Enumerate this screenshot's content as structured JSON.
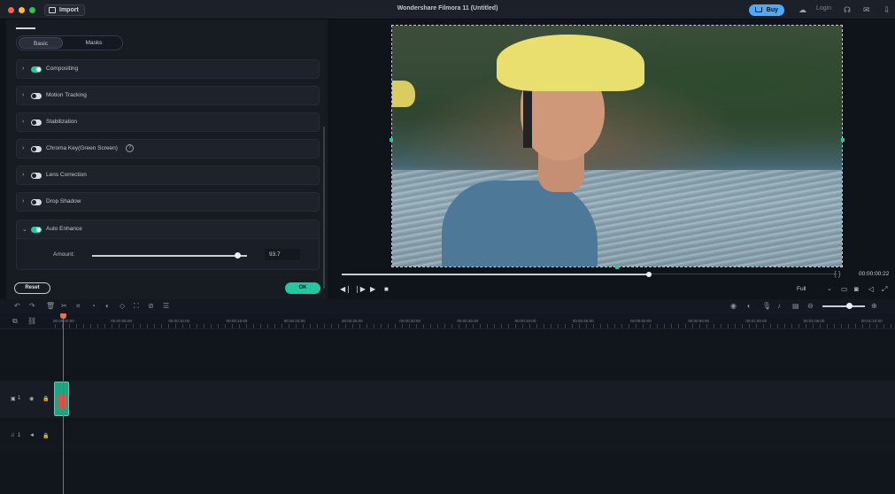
{
  "window": {
    "title": "Wondershare Filmora 11 (Untitled)",
    "import_label": "Import",
    "buy_label": "Buy",
    "login_label": "Login",
    "traffic_lights": [
      "#ff5f57",
      "#febc2e",
      "#28c840"
    ]
  },
  "panel": {
    "tabs": [
      {
        "label": "Basic",
        "active": true
      },
      {
        "label": "Masks",
        "active": false
      }
    ],
    "sections": [
      {
        "label": "Compositing",
        "enabled": true,
        "expanded": false
      },
      {
        "label": "Motion Tracking",
        "enabled": false,
        "expanded": false
      },
      {
        "label": "Stabilization",
        "enabled": false,
        "expanded": false
      },
      {
        "label": "Chroma Key(Green Screen)",
        "enabled": false,
        "expanded": false,
        "help": "?"
      },
      {
        "label": "Lens Correction",
        "enabled": false,
        "expanded": false
      },
      {
        "label": "Drop Shadow",
        "enabled": false,
        "expanded": false
      },
      {
        "label": "Auto Enhance",
        "enabled": true,
        "expanded": true
      }
    ],
    "auto_enhance": {
      "amount_label": "Amount:",
      "amount_value": "93.7",
      "amount_fraction": 0.937
    },
    "reset_label": "Reset",
    "ok_label": "OK"
  },
  "preview": {
    "timecode": "00:00:00:22",
    "braces": "{ }",
    "quality": "Full",
    "progress_fraction": 0.62
  },
  "timeline": {
    "tick_labels": [
      "00:00:00:00",
      "00:00:05:00",
      "00:00:10:00",
      "00:00:15:00",
      "00:00:20:00",
      "00:00:25:00",
      "00:00:30:00",
      "00:00:35:00",
      "00:00:40:00",
      "00:00:45:00",
      "00:00:50:00",
      "00:00:55:00",
      "00:01:00:00",
      "00:01:05:00",
      "00:01:10:00"
    ],
    "video_track_label": "1",
    "audio_track_label": "1"
  },
  "colors": {
    "accent": "#22c9a0",
    "buy": "#4fa9f5",
    "playhead": "#e2463c"
  }
}
